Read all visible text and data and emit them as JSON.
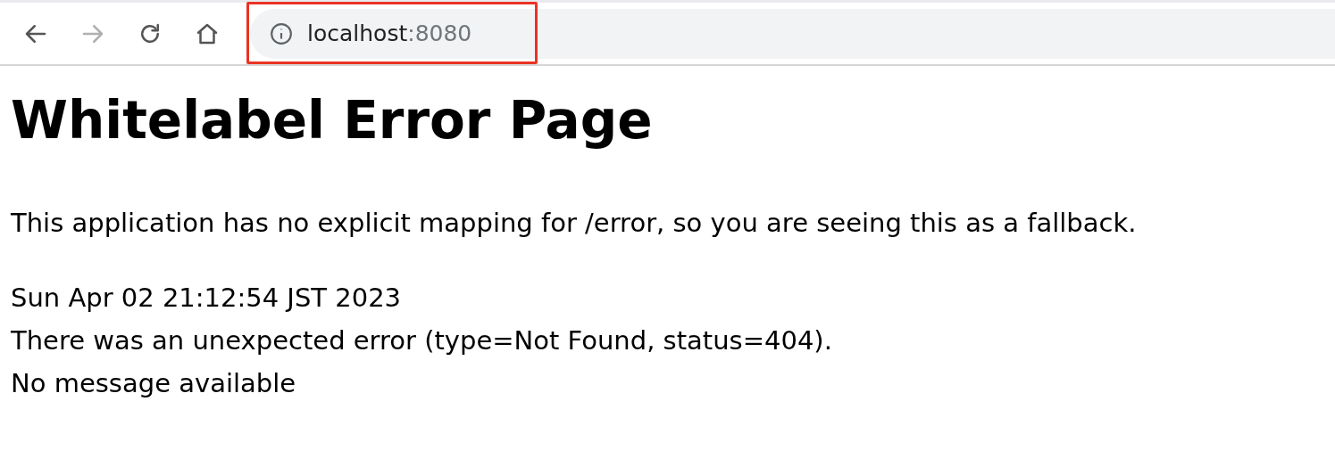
{
  "toolbar": {
    "nav_buttons": [
      {
        "kind": "back",
        "disabled": false
      },
      {
        "kind": "forward",
        "disabled": true
      },
      {
        "kind": "reload",
        "disabled": false
      },
      {
        "kind": "home",
        "disabled": false
      }
    ],
    "address_bar": {
      "host": "localhost",
      "port": ":8080",
      "highlighted": true
    }
  },
  "page": {
    "title": "Whitelabel Error Page",
    "message": "This application has no explicit mapping for /error, so you are seeing this as a fallback.",
    "details": [
      "Sun Apr 02 21:12:54 JST 2023",
      "There was an unexpected error (type=Not Found, status=404).",
      "No message available"
    ]
  }
}
